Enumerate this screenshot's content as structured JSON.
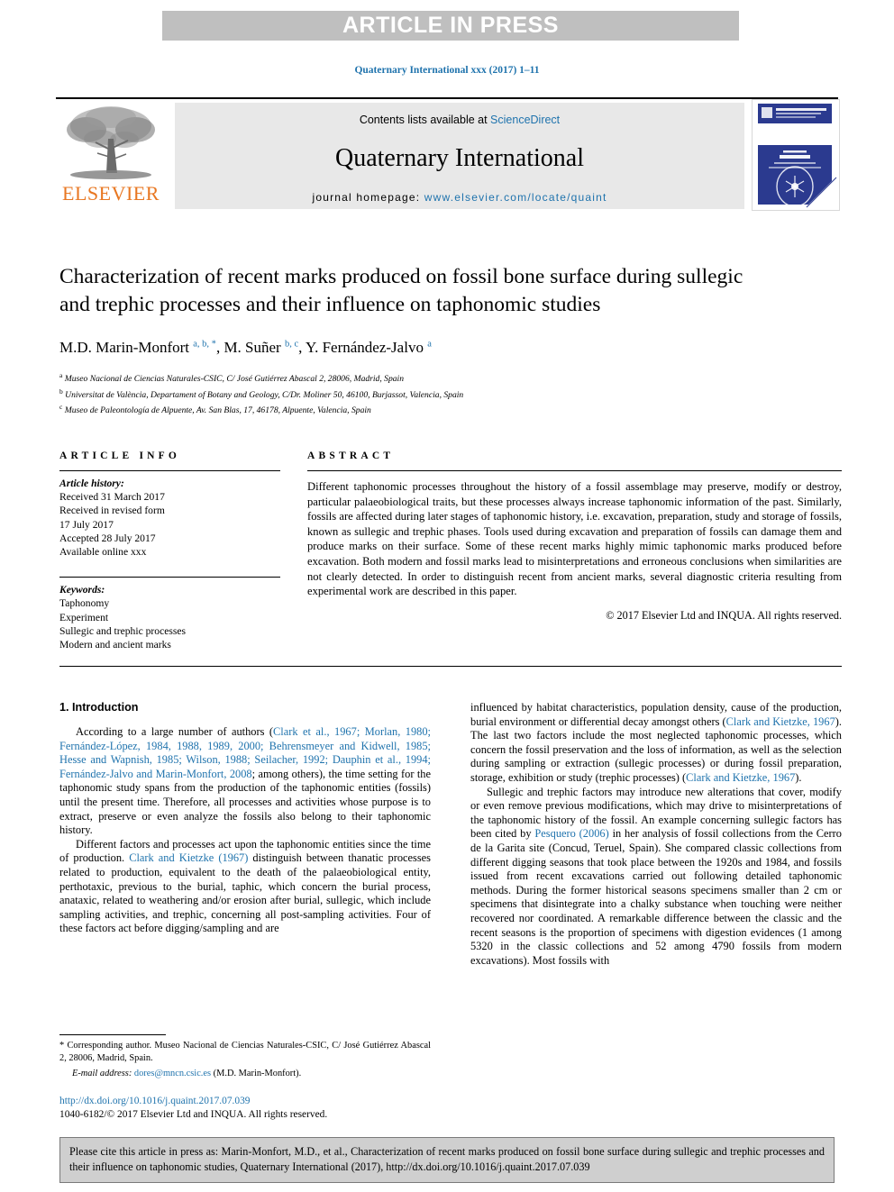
{
  "banner": {
    "label": "ARTICLE IN PRESS"
  },
  "running_head": "Quaternary International xxx (2017) 1–11",
  "masthead": {
    "contents_prefix": "Contents lists available at ",
    "sciencedirect": "ScienceDirect",
    "journal_name": "Quaternary International",
    "homepage_label": "journal homepage: ",
    "homepage_url": "www.elsevier.com/locate/quaint",
    "publisher_wordmark": "ELSEVIER",
    "cover_title": "QUATERNARY INTERNATIONAL",
    "cover_subtitle": "The Journal of the International Union for Quaternary Research",
    "cover_issue": "Vol. xxx",
    "cover_seal": "INQUA"
  },
  "article": {
    "title": "Characterization of recent marks produced on fossil bone surface during sullegic and trephic processes and their influence on taphonomic studies",
    "authors_html": "M.D. Marin-Monfort <sup>a, b, *</sup>, M. Suñer <sup>b, c</sup>, Y. Fernández-Jalvo <sup>a</sup>",
    "affiliations": [
      {
        "mark": "a",
        "text": "Museo Nacional de Ciencias Naturales-CSIC, C/ José Gutiérrez Abascal 2, 28006, Madrid, Spain"
      },
      {
        "mark": "b",
        "text": "Universitat de València, Departament of Botany and Geology, C/Dr. Moliner 50, 46100, Burjassot, Valencia, Spain"
      },
      {
        "mark": "c",
        "text": "Museo de Paleontología de Alpuente, Av. San Blas, 17, 46178, Alpuente, Valencia, Spain"
      }
    ]
  },
  "article_info": {
    "heading": "ARTICLE INFO",
    "history_label": "Article history:",
    "history_lines": [
      "Received 31 March 2017",
      "Received in revised form",
      "17 July 2017",
      "Accepted 28 July 2017",
      "Available online xxx"
    ],
    "keywords_label": "Keywords:",
    "keywords": [
      "Taphonomy",
      "Experiment",
      "Sullegic and trephic processes",
      "Modern and ancient marks"
    ]
  },
  "abstract": {
    "heading": "ABSTRACT",
    "text": "Different taphonomic processes throughout the history of a fossil assemblage may preserve, modify or destroy, particular palaeobiological traits, but these processes always increase taphonomic information of the past. Similarly, fossils are affected during later stages of taphonomic history, i.e. excavation, preparation, study and storage of fossils, known as sullegic and trephic phases. Tools used during excavation and preparation of fossils can damage them and produce marks on their surface. Some of these recent marks highly mimic taphonomic marks produced before excavation. Both modern and fossil marks lead to misinterpretations and erroneous conclusions when similarities are not clearly detected. In order to distinguish recent from ancient marks, several diagnostic criteria resulting from experimental work are described in this paper.",
    "copyright": "© 2017 Elsevier Ltd and INQUA. All rights reserved."
  },
  "body": {
    "section_title": "1. Introduction",
    "left_paragraphs": [
      {
        "segments": [
          {
            "t": "According to a large number of authors (",
            "ref": false
          },
          {
            "t": "Clark et al., 1967; Morlan, 1980; Fernández-López, 1984, 1988, 1989, 2000; Behrensmeyer and Kidwell, 1985; Hesse and Wapnish, 1985; Wilson, 1988; Seilacher, 1992; Dauphin et al., 1994; Fernández-Jalvo and Marin-Monfort, 2008",
            "ref": true
          },
          {
            "t": "; among others), the time setting for the taphonomic study spans from the production of the taphonomic entities (fossils) until the present time. Therefore, all processes and activities whose purpose is to extract, preserve or even analyze the fossils also belong to their taphonomic history.",
            "ref": false
          }
        ]
      },
      {
        "segments": [
          {
            "t": "Different factors and processes act upon the taphonomic entities since the time of production. ",
            "ref": false
          },
          {
            "t": "Clark and Kietzke (1967)",
            "ref": true
          },
          {
            "t": " distinguish between thanatic processes related to production, equivalent to the death of the palaeobiological entity, perthotaxic, previous to the burial, taphic, which concern the burial process, anataxic, related to weathering and/or erosion after burial, sullegic, which include sampling activities, and trephic, concerning all post-sampling activities. Four of these factors act before digging/sampling and are",
            "ref": false
          }
        ]
      }
    ],
    "right_paragraphs": [
      {
        "segments": [
          {
            "t": "influenced by habitat characteristics, population density, cause of the production, burial environment or differential decay amongst others (",
            "ref": false
          },
          {
            "t": "Clark and Kietzke, 1967",
            "ref": true
          },
          {
            "t": "). The last two factors include the most neglected taphonomic processes, which concern the fossil preservation and the loss of information, as well as the selection during sampling or extraction (sullegic processes) or during fossil preparation, storage, exhibition or study (trephic processes) (",
            "ref": false
          },
          {
            "t": "Clark and Kietzke, 1967",
            "ref": true
          },
          {
            "t": ").",
            "ref": false
          }
        ]
      },
      {
        "segments": [
          {
            "t": "Sullegic and trephic factors may introduce new alterations that cover, modify or even remove previous modifications, which may drive to misinterpretations of the taphonomic history of the fossil. An example concerning sullegic factors has been cited by ",
            "ref": false
          },
          {
            "t": "Pesquero (2006)",
            "ref": true
          },
          {
            "t": " in her analysis of fossil collections from the Cerro de la Garita site (Concud, Teruel, Spain). She compared classic collections from different digging seasons that took place between the 1920s and 1984, and fossils issued from recent excavations carried out following detailed taphonomic methods. During the former historical seasons specimens smaller than 2 cm or specimens that disintegrate into a chalky substance when touching were neither recovered nor coordinated. A remarkable difference between the classic and the recent seasons is the proportion of specimens with digestion evidences (1 among 5320 in the classic collections and 52 among 4790 fossils from modern excavations). Most fossils with",
            "ref": false
          }
        ]
      }
    ]
  },
  "footnote": {
    "text": "* Corresponding author. Museo Nacional de Ciencias Naturales-CSIC, C/ José Gutiérrez Abascal 2, 28006, Madrid, Spain.",
    "email_label": "E-mail address:",
    "email": "dores@mncn.csic.es",
    "email_suffix": "(M.D. Marin-Monfort)."
  },
  "doi_block": {
    "doi_url": "http://dx.doi.org/10.1016/j.quaint.2017.07.039",
    "issn_line": "1040-6182/© 2017 Elsevier Ltd and INQUA. All rights reserved."
  },
  "citation_box": {
    "text": "Please cite this article in press as: Marin-Monfort, M.D., et al., Characterization of recent marks produced on fossil bone surface during sullegic and trephic processes and their influence on taphonomic studies, Quaternary International (2017), http://dx.doi.org/10.1016/j.quaint.2017.07.039"
  },
  "colors": {
    "link": "#1f73ad",
    "banner_bg": "#bfbfbf",
    "masthead_bg": "#e8e8e8",
    "elsevier_orange": "#E87722",
    "cite_box_bg": "#cfcfcf",
    "cover_blue": "#2b3a8f"
  }
}
